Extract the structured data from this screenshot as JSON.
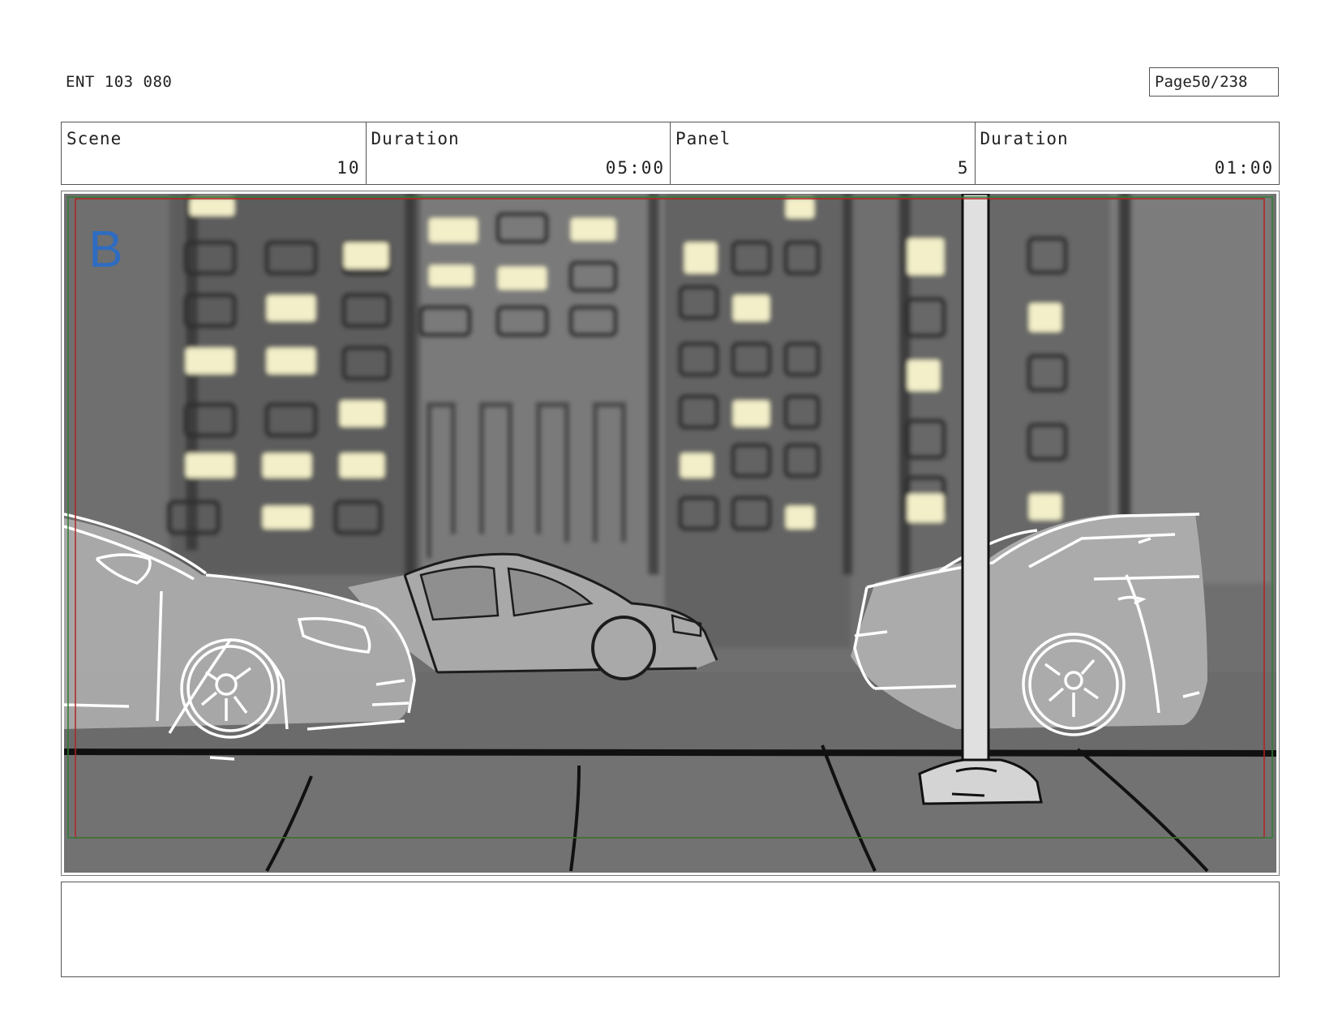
{
  "header": {
    "doc_id": "ENT 103 080",
    "page_label": "Page",
    "page_value": "50/238"
  },
  "info": {
    "scene_label": "Scene",
    "scene_value": "10",
    "scene_duration_label": "Duration",
    "scene_duration_value": "05:00",
    "panel_label": "Panel",
    "panel_value": "5",
    "panel_duration_label": "Duration",
    "panel_duration_value": "01:00"
  },
  "panel": {
    "marker": "B",
    "marker_color": "#2f6cc0",
    "safe_frame_color": "#b22222",
    "action_frame_color": "#2e7d32"
  },
  "notes": {
    "text": ""
  }
}
